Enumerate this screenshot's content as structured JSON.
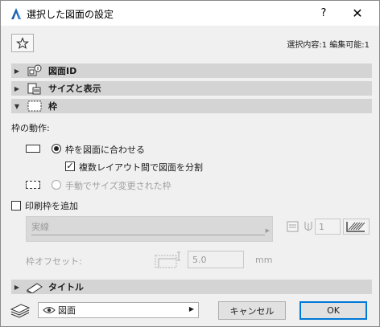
{
  "window": {
    "title": "選択した図面の設定",
    "help_label": "?",
    "close_label": "✕"
  },
  "toolbar": {
    "favorite_icon": "star-icon",
    "selection_info": "選択内容:1 編集可能:1"
  },
  "sections": {
    "drawing_id": {
      "label": "図面ID",
      "expanded": false
    },
    "size_display": {
      "label": "サイズと表示",
      "expanded": false
    },
    "frame": {
      "label": "枠",
      "expanded": true
    },
    "title": {
      "label": "タイトル",
      "expanded": false
    }
  },
  "frame_panel": {
    "behavior_label": "枠の動作:",
    "option_fit": "枠を図面に合わせる",
    "option_split": "複数レイアウト間で図面を分割",
    "option_manual": "手動でサイズ変更された枠",
    "print_frame_label": "印刷枠を追加",
    "line_type_value": "実線",
    "pen_number": "1",
    "offset_label": "枠オフセット:",
    "offset_value": "5.0",
    "offset_unit": "mm"
  },
  "footer": {
    "layer_value": "図面",
    "cancel_label": "キャンセル",
    "ok_label": "OK"
  },
  "colors": {
    "ok_border": "#0078d7",
    "section_bg": "#d4d4d4",
    "dialog_bg": "#f0f0f0"
  }
}
